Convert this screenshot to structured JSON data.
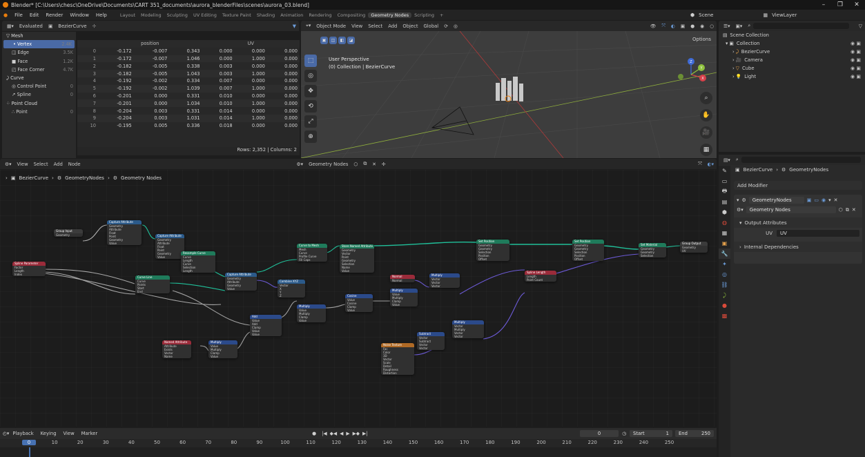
{
  "window": {
    "title": "Blender* [C:\\Users\\chesc\\OneDrive\\Documents\\CART 351_documents\\aurora_blenderFiles\\scenes\\aurora_03.blend]"
  },
  "menus": [
    "File",
    "Edit",
    "Render",
    "Window",
    "Help"
  ],
  "workspaces": [
    "Layout",
    "Modeling",
    "Sculpting",
    "UV Editing",
    "Texture Paint",
    "Shading",
    "Animation",
    "Rendering",
    "Compositing",
    "Geometry Nodes",
    "Scripting"
  ],
  "active_workspace": "Geometry Nodes",
  "scene": {
    "name": "Scene",
    "view_layer": "ViewLayer"
  },
  "spreadsheet": {
    "header": {
      "mode": "Evaluated",
      "object": "BezierCurve"
    },
    "domains": [
      {
        "label": "Mesh",
        "count": "",
        "type": "group"
      },
      {
        "label": "Vertex",
        "count": "2.4K",
        "type": "selected"
      },
      {
        "label": "Edge",
        "count": "3.5K",
        "type": "item"
      },
      {
        "label": "Face",
        "count": "1.2K",
        "type": "item"
      },
      {
        "label": "Face Corner",
        "count": "4.7K",
        "type": "item"
      },
      {
        "label": "Curve",
        "count": "",
        "type": "group"
      },
      {
        "label": "Control Point",
        "count": "0",
        "type": "item"
      },
      {
        "label": "Spline",
        "count": "0",
        "type": "item"
      },
      {
        "label": "Point Cloud",
        "count": "",
        "type": "group"
      },
      {
        "label": "Point",
        "count": "0",
        "type": "item"
      }
    ],
    "columns": {
      "position": "position",
      "uv": "UV"
    },
    "rows": [
      [
        "0",
        "-0.172",
        "-0.007",
        "0.343",
        "0.000",
        "0.000",
        "0.000"
      ],
      [
        "1",
        "-0.172",
        "-0.007",
        "1.046",
        "0.000",
        "1.000",
        "0.000"
      ],
      [
        "2",
        "-0.182",
        "-0.005",
        "0.338",
        "0.003",
        "0.000",
        "0.000"
      ],
      [
        "3",
        "-0.182",
        "-0.005",
        "1.043",
        "0.003",
        "1.000",
        "0.000"
      ],
      [
        "4",
        "-0.192",
        "-0.002",
        "0.334",
        "0.007",
        "0.000",
        "0.000"
      ],
      [
        "5",
        "-0.192",
        "-0.002",
        "1.039",
        "0.007",
        "1.000",
        "0.000"
      ],
      [
        "6",
        "-0.201",
        "0.000",
        "0.331",
        "0.010",
        "0.000",
        "0.000"
      ],
      [
        "7",
        "-0.201",
        "0.000",
        "1.034",
        "0.010",
        "1.000",
        "0.000"
      ],
      [
        "8",
        "-0.204",
        "0.003",
        "0.331",
        "0.014",
        "0.000",
        "0.000"
      ],
      [
        "9",
        "-0.204",
        "0.003",
        "1.031",
        "0.014",
        "1.000",
        "0.000"
      ],
      [
        "10",
        "-0.195",
        "0.005",
        "0.336",
        "0.018",
        "0.000",
        "0.000"
      ]
    ],
    "footer": "Rows: 2,352  |  Columns: 2"
  },
  "viewport": {
    "header_items": [
      "Object Mode",
      "View",
      "Select",
      "Add",
      "Object",
      "Global"
    ],
    "options": "Options",
    "label_line1": "User Perspective",
    "label_line2": "(0) Collection | BezierCurve",
    "gizmo": {
      "x": "X",
      "y": "Y",
      "z": "Z"
    }
  },
  "outliner": {
    "title": "Scene Collection",
    "items": [
      {
        "label": "Collection",
        "indent": 1,
        "icon": "collection-icon",
        "color": "#d0d0d0"
      },
      {
        "label": "BezierCurve",
        "indent": 2,
        "icon": "curve-icon",
        "color": "#e3a04b"
      },
      {
        "label": "Camera",
        "indent": 2,
        "icon": "camera-icon",
        "color": "#e3a04b"
      },
      {
        "label": "Cube",
        "indent": 2,
        "icon": "mesh-icon",
        "color": "#e3a04b"
      },
      {
        "label": "Light",
        "indent": 2,
        "icon": "light-icon",
        "color": "#e3a04b"
      }
    ]
  },
  "node_editor": {
    "header_items": [
      "View",
      "Select",
      "Add",
      "Node"
    ],
    "tree_name": "Geometry Nodes",
    "breadcrumb": [
      "BezierCurve",
      "GeometryNodes",
      "Geometry Nodes"
    ],
    "nodes": [
      {
        "name": "Group Input",
        "color": "#3b3b3b",
        "rows": [
          "Geometry"
        ]
      },
      {
        "name": "Capture Attribute",
        "color": "#2b5a8a",
        "rows": [
          "Geometry",
          "Attribute",
          "Float",
          "Point",
          "Geometry",
          "Value"
        ]
      },
      {
        "name": "Capture Attribute",
        "color": "#2b5a8a",
        "rows": [
          "Geometry",
          "Attribute",
          "Float",
          "Point",
          "Geometry",
          "Value"
        ]
      },
      {
        "name": "Spline Parameter",
        "color": "#9b2b3a",
        "rows": [
          "Factor",
          "Length",
          "Index"
        ]
      },
      {
        "name": "Resample Curve",
        "color": "#1f7b5b",
        "rows": [
          "Curve",
          "Length",
          "Curve",
          "Selection",
          "Length"
        ]
      },
      {
        "name": "Curve Line",
        "color": "#1f7b5b",
        "rows": [
          "Curve",
          "Points",
          "Start",
          "End"
        ]
      },
      {
        "name": "Capture Attribute",
        "color": "#2b5a8a",
        "rows": [
          "Geometry",
          "Attribute",
          "Geometry",
          "Value"
        ]
      },
      {
        "name": "Combine XYZ",
        "color": "#2b5a8a",
        "rows": [
          "Vector",
          "X",
          "Y",
          "Z"
        ]
      },
      {
        "name": "Curve to Mesh",
        "color": "#1f7b5b",
        "rows": [
          "Mesh",
          "Curve",
          "Profile Curve",
          "Fill Caps"
        ]
      },
      {
        "name": "Store Named Attribute",
        "color": "#1f7b5b",
        "rows": [
          "Geometry",
          "Vector",
          "Point",
          "Geometry",
          "Selection",
          "Name",
          "Value"
        ]
      },
      {
        "name": "Set Position",
        "color": "#1f7b5b",
        "rows": [
          "Geometry",
          "Geometry",
          "Selection",
          "Position",
          "Offset"
        ]
      },
      {
        "name": "Set Position",
        "color": "#1f7b5b",
        "rows": [
          "Geometry",
          "Geometry",
          "Selection",
          "Position",
          "Offset"
        ]
      },
      {
        "name": "Set Material",
        "color": "#1f7b5b",
        "rows": [
          "Geometry",
          "Geometry",
          "Selection"
        ]
      },
      {
        "name": "Group Output",
        "color": "#3b3b3b",
        "rows": [
          "Geometry",
          "UV"
        ]
      },
      {
        "name": "Normal",
        "color": "#9b2b3a",
        "rows": [
          "Normal"
        ]
      },
      {
        "name": "Multiply",
        "color": "#2b4a8a",
        "rows": [
          "Vector",
          "Vector",
          "Vector"
        ]
      },
      {
        "name": "Multiply",
        "color": "#2b4a8a",
        "rows": [
          "Value",
          "Multiply",
          "Clamp",
          "Value"
        ]
      },
      {
        "name": "Cosine",
        "color": "#2b4a8a",
        "rows": [
          "Value",
          "Cosine",
          "Clamp",
          "Value"
        ]
      },
      {
        "name": "Multiply",
        "color": "#2b4a8a",
        "rows": [
          "Value",
          "Multiply",
          "Clamp",
          "Value"
        ]
      },
      {
        "name": "Add",
        "color": "#2b4a8a",
        "rows": [
          "Value",
          "Add",
          "Clamp",
          "Value",
          "Value"
        ]
      },
      {
        "name": "Multiply",
        "color": "#2b4a8a",
        "rows": [
          "Value",
          "Multiply",
          "Clamp",
          "Value"
        ]
      },
      {
        "name": "Named Attribute",
        "color": "#9b2b3a",
        "rows": [
          "Attribute",
          "Exists",
          "Vector",
          "Name"
        ]
      },
      {
        "name": "Noise Texture",
        "color": "#b06a25",
        "rows": [
          "Fac",
          "Color",
          "3D",
          "Vector",
          "Scale",
          "Detail",
          "Roughness",
          "Distortion"
        ]
      },
      {
        "name": "Subtract",
        "color": "#2b4a8a",
        "rows": [
          "Vector",
          "Subtract",
          "Vector",
          "Vector"
        ]
      },
      {
        "name": "Multiply",
        "color": "#2b4a8a",
        "rows": [
          "Vector",
          "Multiply",
          "Vector",
          "Vector"
        ]
      },
      {
        "name": "Spline Length",
        "color": "#9b2b3a",
        "rows": [
          "Length",
          "Point Count"
        ]
      }
    ]
  },
  "properties": {
    "breadcrumb": [
      "BezierCurve",
      "GeometryNodes"
    ],
    "add_modifier": "Add Modifier",
    "modifier_name": "GeometryNodes",
    "node_group": "Geometry Nodes",
    "output_attributes": "Output Attributes",
    "uv_label": "UV",
    "uv_value": "UV",
    "internal_dependencies": "Internal Dependencies"
  },
  "timeline": {
    "header_items": [
      "Playback",
      "Keying",
      "View",
      "Marker"
    ],
    "current_frame": "0",
    "start_label": "Start",
    "start": "1",
    "end_label": "End",
    "end": "250",
    "ruler": [
      "0",
      "10",
      "20",
      "30",
      "40",
      "50",
      "60",
      "70",
      "80",
      "90",
      "100",
      "110",
      "120",
      "130",
      "140",
      "150",
      "160",
      "170",
      "180",
      "190",
      "200",
      "210",
      "220",
      "230",
      "240",
      "250"
    ]
  }
}
